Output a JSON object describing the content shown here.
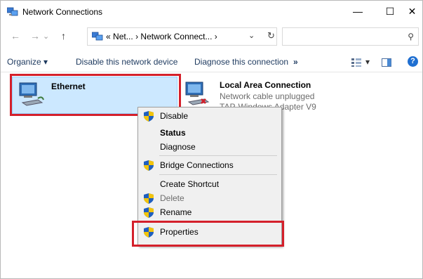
{
  "window": {
    "title": "Network Connections",
    "minimize": "—",
    "maximize": "☐",
    "close": "✕"
  },
  "nav": {
    "back": "←",
    "forward": "→",
    "up": "↑"
  },
  "address": {
    "prefix": "«",
    "crumb1": "Net...",
    "sep1": "›",
    "crumb2": "Network Connect...",
    "sep2": "›",
    "dropdown": "⌄",
    "refresh": "↻"
  },
  "search": {
    "placeholder": "",
    "icon": "⚲"
  },
  "toolbar": {
    "organize": "Organize ▾",
    "disable": "Disable this network device",
    "diagnose": "Diagnose this connection",
    "more": "»",
    "view_options": "▾",
    "help": "?"
  },
  "connections": [
    {
      "name": "Ethernet",
      "status": "",
      "adapter": ""
    },
    {
      "name": "Local Area Connection",
      "status": "Network cable unplugged",
      "adapter": "TAP-Windows Adapter V9"
    }
  ],
  "context_menu": {
    "items": [
      {
        "label": "Disable",
        "bold": false,
        "icon": "shield-icon",
        "disabled": false
      },
      {
        "label": "Status",
        "bold": true,
        "icon": "",
        "disabled": false
      },
      {
        "label": "Diagnose",
        "bold": false,
        "icon": "",
        "disabled": false
      },
      {
        "label": "Bridge Connections",
        "bold": false,
        "icon": "shield-icon",
        "disabled": false
      },
      {
        "label": "Create Shortcut",
        "bold": false,
        "icon": "",
        "disabled": false
      },
      {
        "label": "Delete",
        "bold": false,
        "icon": "shield-icon",
        "disabled": true
      },
      {
        "label": "Rename",
        "bold": false,
        "icon": "shield-icon",
        "disabled": false
      },
      {
        "label": "Properties",
        "bold": false,
        "icon": "shield-icon",
        "disabled": false
      }
    ]
  },
  "colors": {
    "highlight": "#d4202b",
    "selection": "#cce8ff",
    "link": "#1e3a5f"
  }
}
